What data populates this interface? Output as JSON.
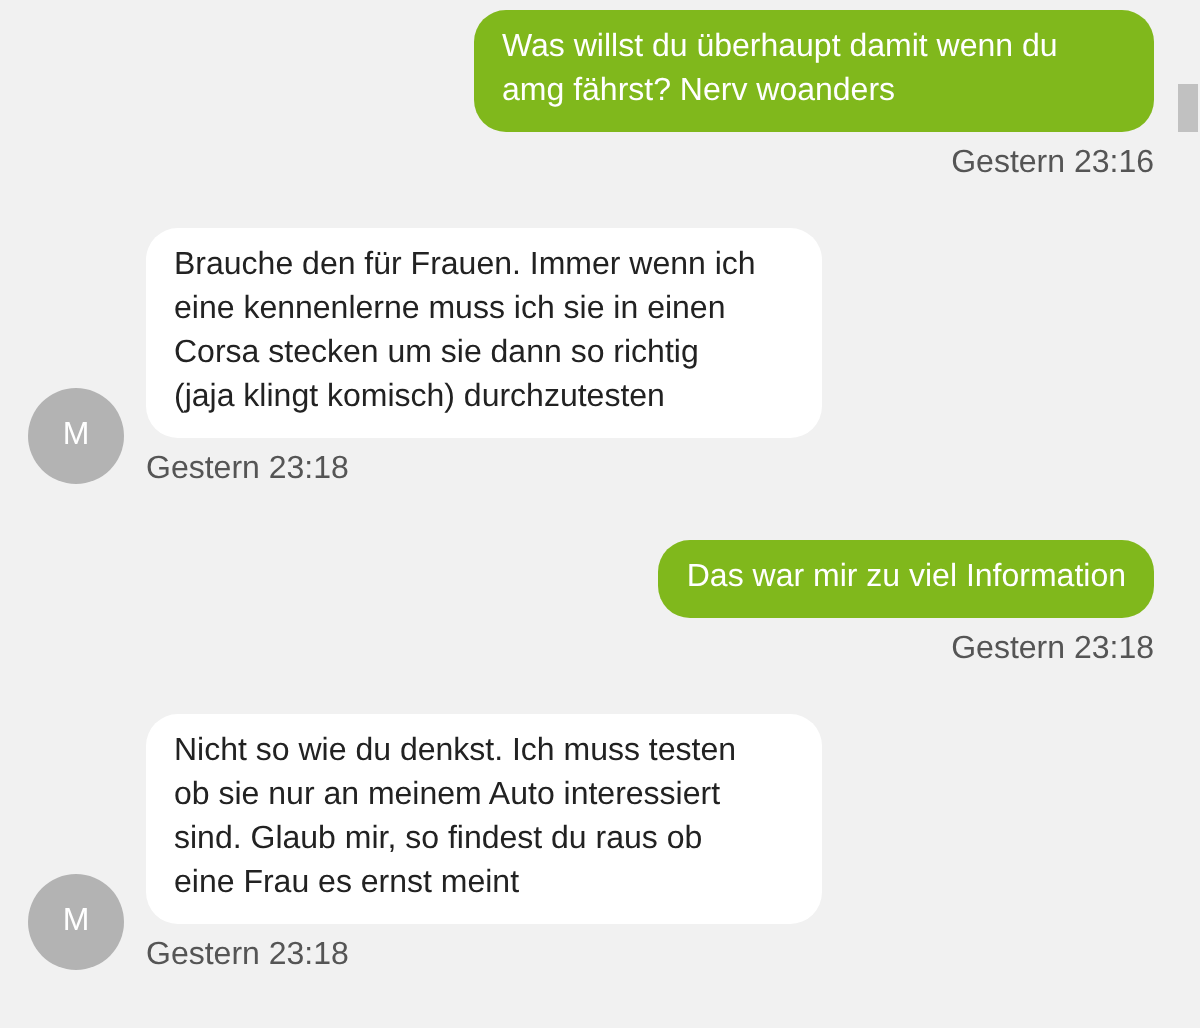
{
  "messages": [
    {
      "kind": "outgoing",
      "text": "Was willst du überhaupt damit wenn du amg fährst? Nerv woanders",
      "time": "Gestern 23:16"
    },
    {
      "kind": "incoming",
      "avatar": "M",
      "text": "Brauche den für Frauen. Immer wenn ich eine kennenlerne muss ich sie in einen Corsa stecken um sie dann so richtig (jaja klingt komisch) durchzutesten",
      "time": "Gestern 23:18"
    },
    {
      "kind": "outgoing",
      "text": "Das war mir zu viel Information",
      "time": "Gestern 23:18"
    },
    {
      "kind": "incoming",
      "avatar": "M",
      "text": "Nicht so wie du denkst. Ich muss testen ob sie nur an meinem Auto interessiert sind. Glaub mir, so findest du raus ob eine Frau es ernst meint",
      "time": "Gestern 23:18"
    }
  ]
}
